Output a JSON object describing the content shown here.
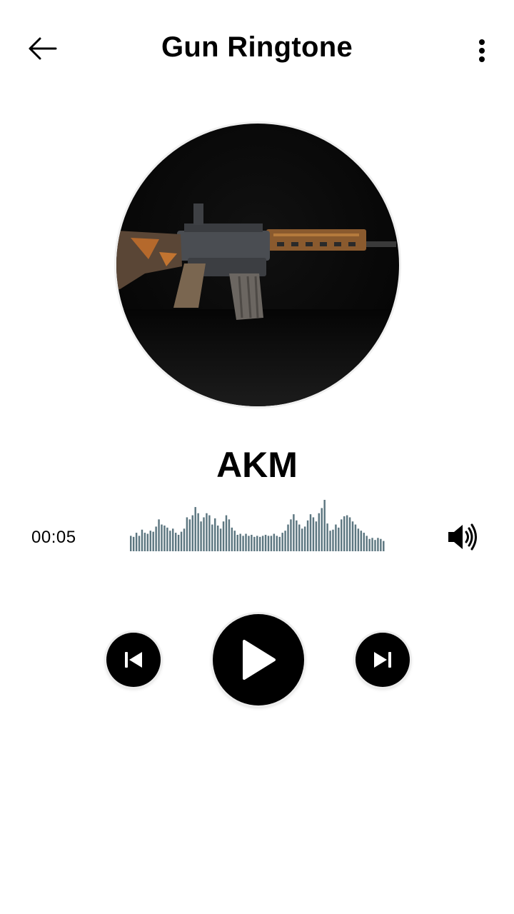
{
  "header": {
    "title": "Gun Ringtone",
    "back_icon": "arrow-left-icon",
    "menu_icon": "more-vertical-icon"
  },
  "now_playing": {
    "cover_alt": "rifle-artwork",
    "track_title": "AKM",
    "elapsed": "00:05",
    "waveform_levels": [
      0.3,
      0.28,
      0.36,
      0.3,
      0.42,
      0.36,
      0.34,
      0.4,
      0.38,
      0.48,
      0.62,
      0.52,
      0.5,
      0.46,
      0.4,
      0.44,
      0.36,
      0.32,
      0.38,
      0.44,
      0.66,
      0.62,
      0.7,
      0.86,
      0.74,
      0.58,
      0.66,
      0.74,
      0.7,
      0.52,
      0.64,
      0.5,
      0.44,
      0.58,
      0.7,
      0.62,
      0.46,
      0.4,
      0.32,
      0.34,
      0.3,
      0.34,
      0.3,
      0.32,
      0.28,
      0.3,
      0.28,
      0.3,
      0.32,
      0.3,
      0.3,
      0.34,
      0.3,
      0.28,
      0.36,
      0.4,
      0.52,
      0.62,
      0.72,
      0.6,
      0.52,
      0.44,
      0.48,
      0.6,
      0.72,
      0.66,
      0.58,
      0.74,
      0.84,
      1.0,
      0.54,
      0.4,
      0.42,
      0.52,
      0.46,
      0.62,
      0.68,
      0.7,
      0.66,
      0.58,
      0.52,
      0.44,
      0.4,
      0.36,
      0.3,
      0.24,
      0.26,
      0.22,
      0.26,
      0.24,
      0.2
    ],
    "waveform_color": "#5c7680"
  },
  "controls": {
    "prev_icon": "skip-previous-icon",
    "play_icon": "play-icon",
    "next_icon": "skip-next-icon",
    "volume_icon": "volume-up-icon"
  }
}
